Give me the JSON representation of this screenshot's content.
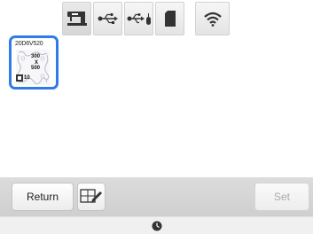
{
  "tabs": [
    {
      "icon": "machine-memory-icon",
      "active": true
    },
    {
      "icon": "usb-icon",
      "active": false
    },
    {
      "icon": "usb-mouse-icon",
      "active": false
    },
    {
      "icon": "sd-card-icon",
      "active": false
    },
    {
      "icon": "wifi-icon",
      "active": false
    }
  ],
  "file": {
    "name": "20D6V520",
    "width": "300",
    "separator": "X",
    "height": "500",
    "colors": "10",
    "selected": true
  },
  "buttons": {
    "return_label": "Return",
    "edit_icon": "edit-pattern-icon",
    "set_label": "Set",
    "set_enabled": false
  },
  "status": {
    "icon": "clock-icon"
  },
  "colors": {
    "selection": "#2f7be8",
    "tab_bg": "#e8e8e8",
    "bottom_bar": "#d6d6d6",
    "disabled_text": "#aaaaaa"
  }
}
